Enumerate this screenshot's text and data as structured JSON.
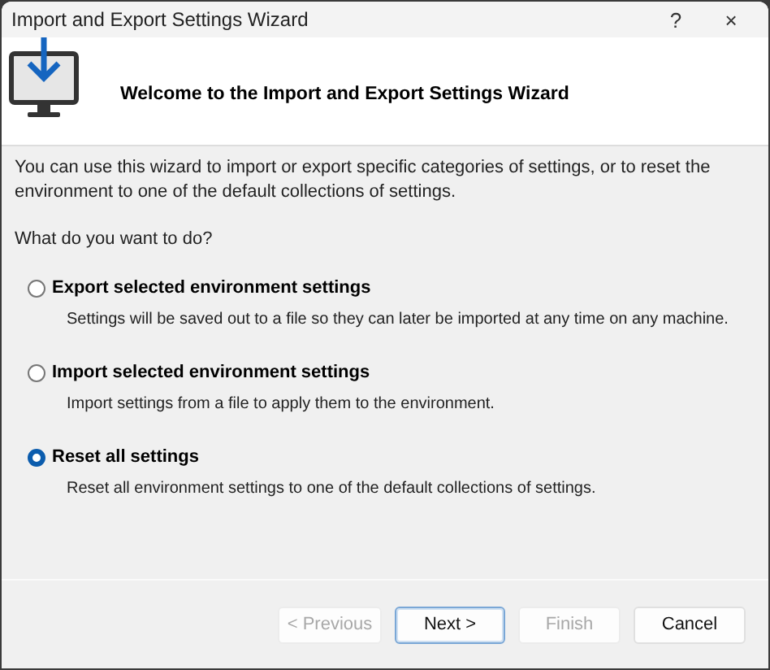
{
  "window": {
    "title": "Import and Export Settings Wizard",
    "help": "?",
    "close": "×"
  },
  "header": {
    "heading": "Welcome to the Import and Export Settings Wizard"
  },
  "intro": "You can use this wizard to import or export specific categories of settings, or to reset the environment to one of the default collections of settings.",
  "question": "What do you want to do?",
  "options": [
    {
      "label": "Export selected environment settings",
      "description": "Settings will be saved out to a file so they can later be imported at any time on any machine.",
      "selected": false
    },
    {
      "label": "Import selected environment settings",
      "description": "Import settings from a file to apply them to the environment.",
      "selected": false
    },
    {
      "label": "Reset all settings",
      "description": "Reset all environment settings to one of the default collections of settings.",
      "selected": true
    }
  ],
  "buttons": [
    {
      "label": "< Previous",
      "disabled": true,
      "default": false
    },
    {
      "label": "Next >",
      "disabled": false,
      "default": true
    },
    {
      "label": "Finish",
      "disabled": true,
      "default": false
    },
    {
      "label": "Cancel",
      "disabled": false,
      "default": false
    }
  ]
}
